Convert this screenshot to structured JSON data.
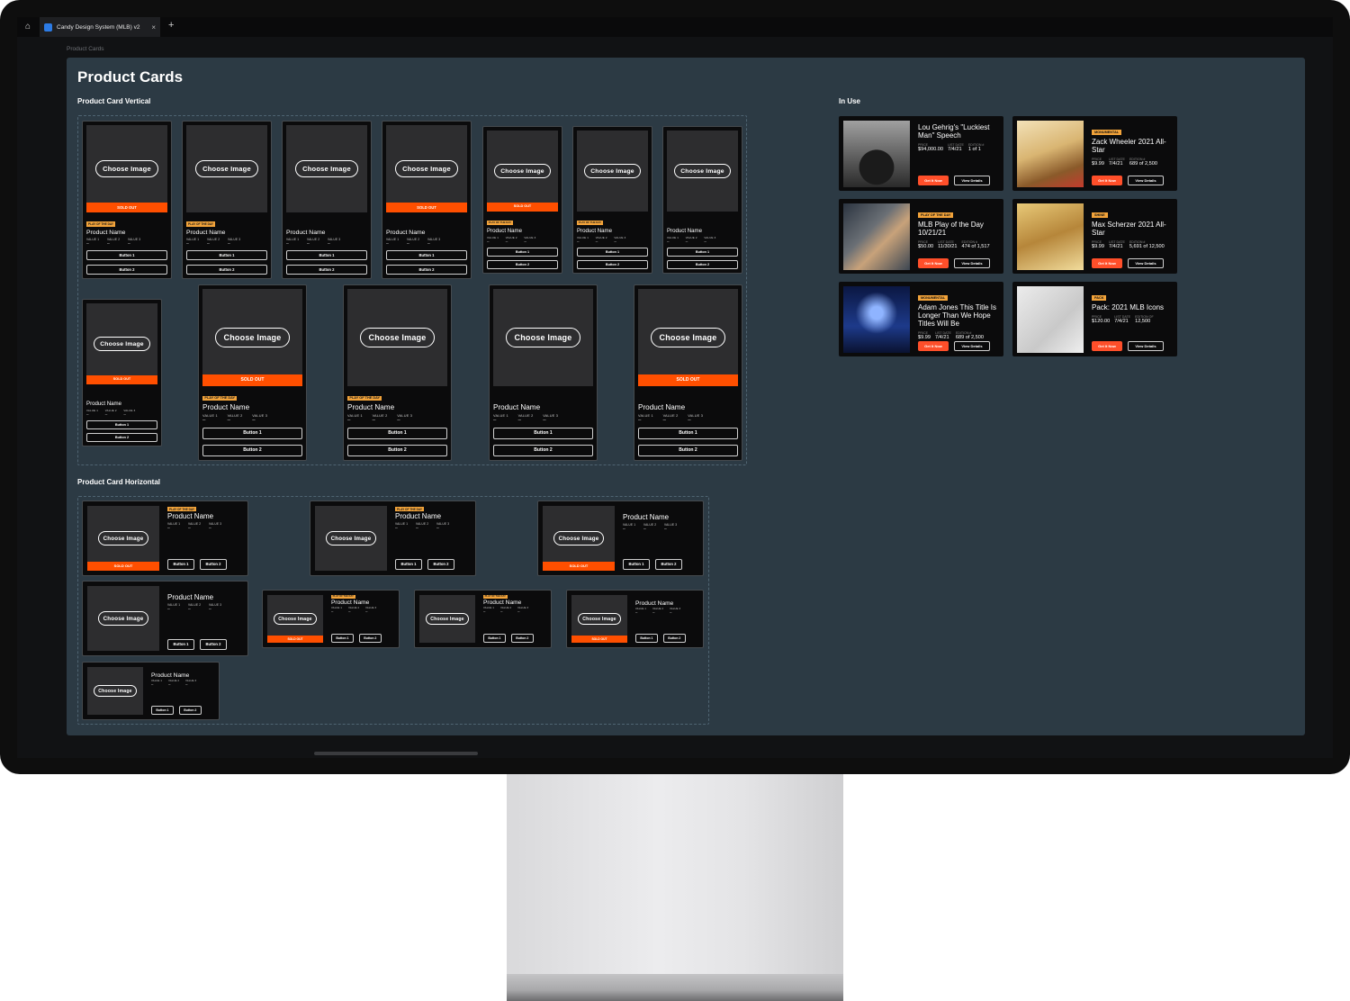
{
  "browser": {
    "tab_title": "Candy Design System (MLB) v2",
    "close": "×",
    "add": "+"
  },
  "breadcrumb": "Product Cards",
  "page_title": "Product Cards",
  "sections": {
    "vertical": "Product Card Vertical",
    "horizontal": "Product Card Horizontal",
    "in_use": "In Use"
  },
  "card": {
    "choose_image": "Choose Image",
    "sold_out": "SOLD OUT",
    "tag": "PLAY OF THE DAY",
    "product_name": "Product Name",
    "values": [
      "VALUE 1",
      "VALUE 2",
      "VALUE 3"
    ],
    "dash": "–",
    "button1": "Button 1",
    "button2": "Button 2"
  },
  "vertical_cards": [
    {
      "sold": true,
      "tag": true
    },
    {
      "sold": false,
      "tag": true
    },
    {
      "sold": false,
      "tag": false
    },
    {
      "sold": true,
      "tag": false
    },
    {
      "sold": true,
      "tag": true
    },
    {
      "sold": false,
      "tag": true
    },
    {
      "sold": false,
      "tag": false
    },
    {
      "sold": true,
      "tag": false
    },
    {
      "sold": true,
      "tag": true
    },
    {
      "sold": false,
      "tag": true
    },
    {
      "sold": false,
      "tag": false
    },
    {
      "sold": true,
      "tag": false
    }
  ],
  "horizontal_cards": [
    {
      "sold": true,
      "tag": true
    },
    {
      "sold": false,
      "tag": true
    },
    {
      "sold": true,
      "tag": false
    },
    {
      "sold": false,
      "tag": false
    },
    {
      "sold": true,
      "tag": true
    },
    {
      "sold": false,
      "tag": true
    },
    {
      "sold": true,
      "tag": false
    },
    {
      "sold": false,
      "tag": false
    }
  ],
  "in_use": {
    "labels": {
      "price": "PRICE",
      "list_date": "LIST DATE",
      "edition": "EDITION #",
      "edition_of": "EDITION OF"
    },
    "get_it_now": "Get It Now",
    "view_details": "View Details",
    "items": [
      {
        "tag": "",
        "title": "Lou Gehrig's \"Luckiest Man\" Speech",
        "price": "$94,000.00",
        "list_date": "7/4/21",
        "edition": "1 of 1",
        "edition_label": "edition"
      },
      {
        "tag": "MONUMENTAL",
        "title": "Zack Wheeler 2021 All-Star",
        "price": "$9.99",
        "list_date": "7/4/21",
        "edition": "689 of 2,500",
        "edition_label": "edition"
      },
      {
        "tag": "PLAY OF THE DAY",
        "title": "MLB Play of the Day 10/21/21",
        "price": "$50.00",
        "list_date": "11/30/21",
        "edition": "474 of 1,517",
        "edition_label": "edition"
      },
      {
        "tag": "SHINE",
        "title": "Max Scherzer 2021 All-Star",
        "price": "$9.99",
        "list_date": "7/4/21",
        "edition": "5,691 of 12,500",
        "edition_label": "edition"
      },
      {
        "tag": "MONUMENTAL",
        "title": "Adam Jones This Title Is Longer Than We Hope Titles Will Be",
        "price": "$9.99",
        "list_date": "7/4/21",
        "edition": "689 of 2,500",
        "edition_label": "edition"
      },
      {
        "tag": "PACK",
        "title": "Pack: 2021 MLB Icons",
        "price": "$120.00",
        "list_date": "7/4/21",
        "edition": "12,500",
        "edition_label": "edition_of"
      }
    ]
  },
  "colors": {
    "accent": "#ff4f00",
    "tag": "#f2a33a",
    "frame": "#2c3a44",
    "card": "#0b0b0c"
  }
}
